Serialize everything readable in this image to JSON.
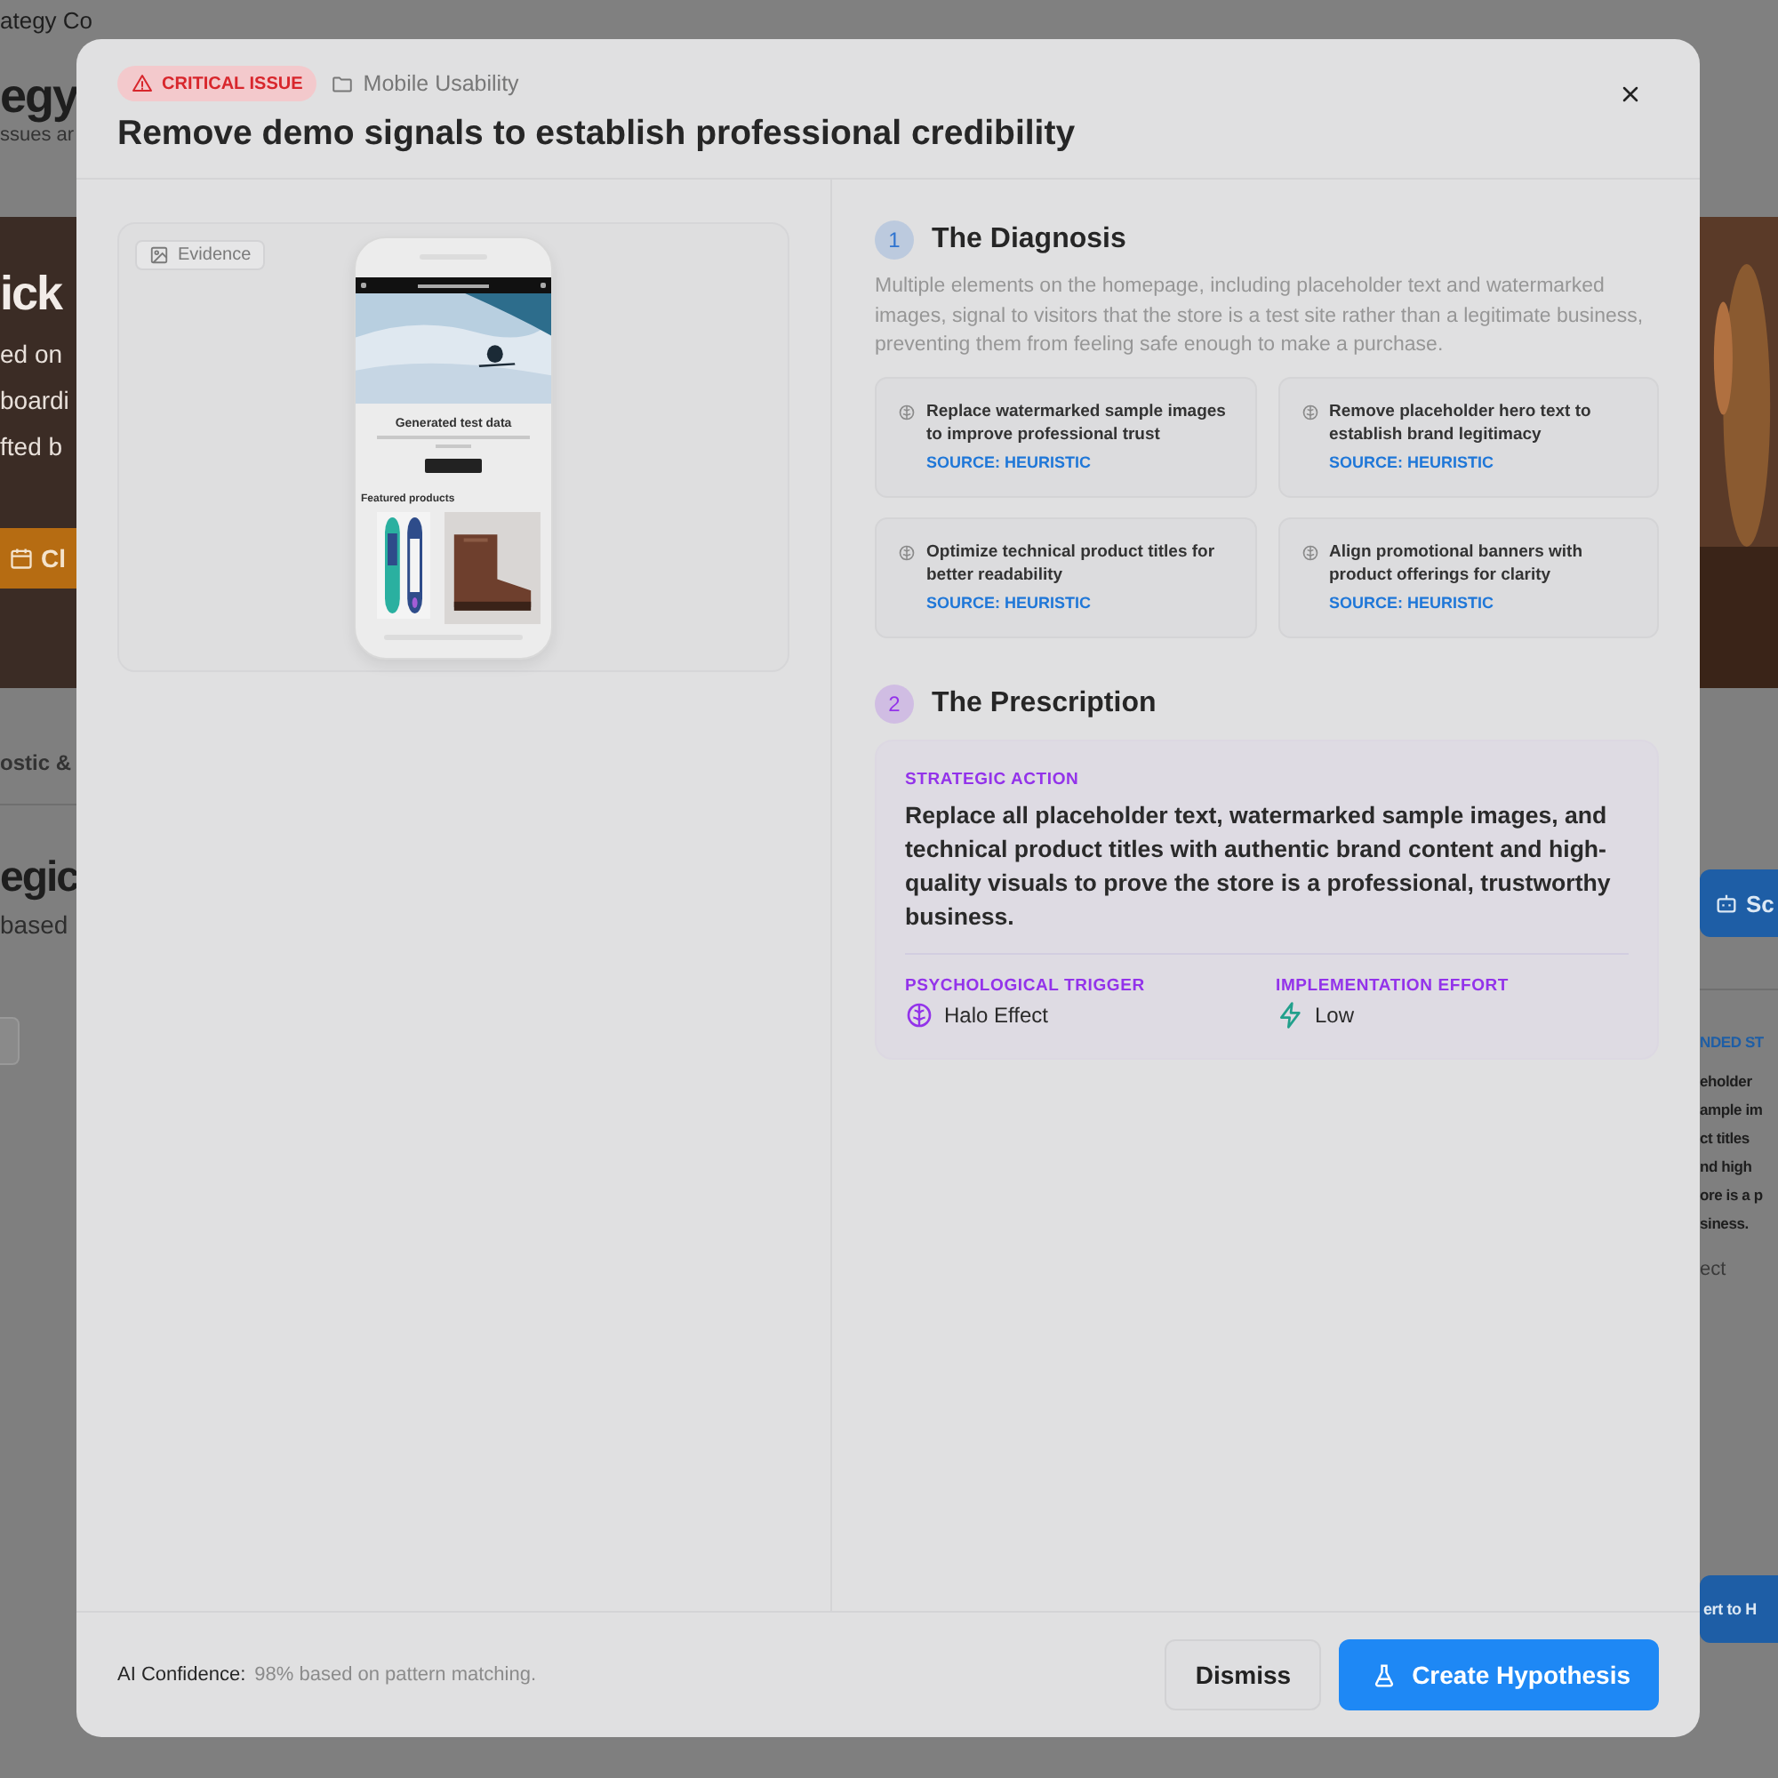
{
  "background": {
    "breadcrumb": "ategy Co",
    "page_title": "egy",
    "page_subtitle": "ssues ar",
    "hero": {
      "title": "ick",
      "lines": [
        "ed on",
        "boardi",
        "fted b"
      ],
      "button": "Cl"
    },
    "tab": "ostic &",
    "section_title": "egic",
    "section_subtitle": "based",
    "side_button": "Sc",
    "side_panel": {
      "heading": "NDED ST",
      "lines": [
        "eholder",
        "ample im",
        "ct titles",
        "nd high",
        "ore is a p",
        "siness."
      ],
      "footer": "ect"
    },
    "bottom_button": "ert to H"
  },
  "modal": {
    "badge": {
      "kind": "critical",
      "label": "CRITICAL ISSUE"
    },
    "category": "Mobile Usability",
    "title": "Remove demo signals to establish professional credibility",
    "evidence": {
      "label": "Evidence",
      "phone": {
        "hero_heading": "Generated test data",
        "section_heading": "Featured products"
      }
    },
    "diagnosis": {
      "step": "1",
      "color": "#2f74d0",
      "title": "The Diagnosis",
      "summary": "Multiple elements on the homepage, including placeholder text and watermarked images, signal to visitors that the store is a test site rather than a legitimate business, preventing them from feeling safe enough to make a purchase.",
      "findings": [
        {
          "text": "Replace watermarked sample images to improve professional trust",
          "source": "SOURCE: HEURISTIC"
        },
        {
          "text": "Remove placeholder hero text to establish brand legitimacy",
          "source": "SOURCE: HEURISTIC"
        },
        {
          "text": "Optimize technical product titles for better readability",
          "source": "SOURCE: HEURISTIC"
        },
        {
          "text": "Align promotional banners with product offerings for clarity",
          "source": "SOURCE: HEURISTIC"
        }
      ]
    },
    "prescription": {
      "step": "2",
      "color": "#9333ea",
      "title": "The Prescription",
      "action_label": "STRATEGIC ACTION",
      "action": "Replace all placeholder text, watermarked sample images, and technical product titles with authentic brand content and high-quality visuals to prove the store is a professional, trustworthy business.",
      "trigger_label": "PSYCHOLOGICAL TRIGGER",
      "trigger": "Halo Effect",
      "effort_label": "IMPLEMENTATION EFFORT",
      "effort": "Low"
    },
    "footer": {
      "confidence_label": "AI Confidence:",
      "confidence": "98% based on pattern matching.",
      "buttons": [
        {
          "label": "Dismiss",
          "kind": "secondary"
        },
        {
          "label": "Create Hypothesis",
          "kind": "primary"
        }
      ]
    }
  }
}
